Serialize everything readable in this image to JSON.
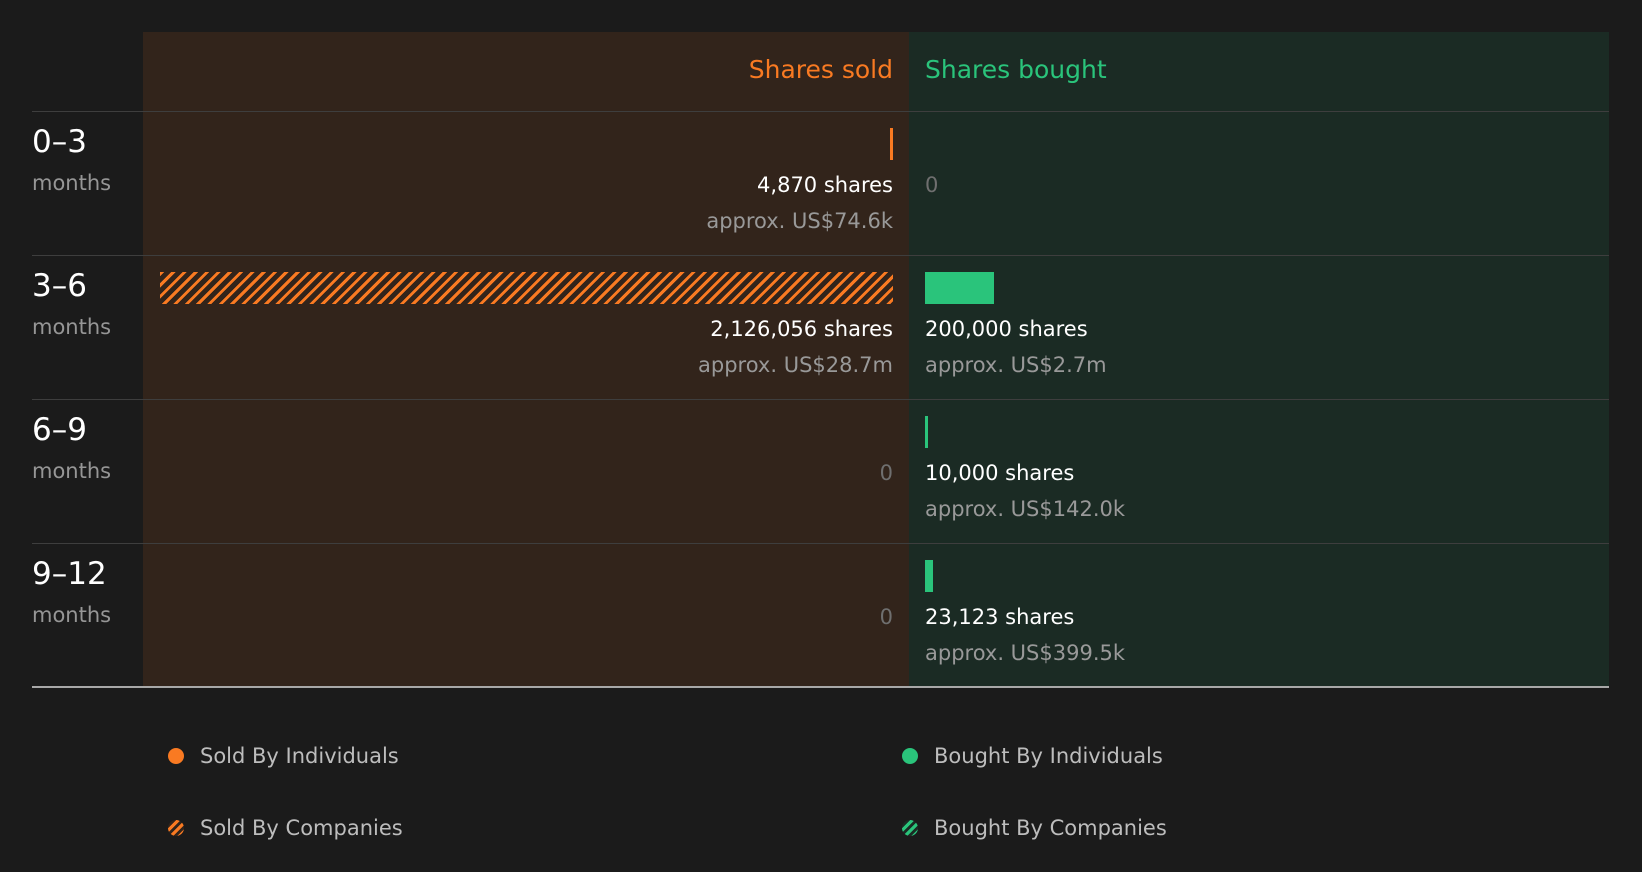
{
  "chart_data": {
    "type": "bar",
    "columns": {
      "sold": "Shares sold",
      "bought": "Shares bought"
    },
    "unit": "months",
    "categories": [
      "0–3",
      "3–6",
      "6–9",
      "9–12"
    ],
    "rows": [
      {
        "range": "0–3",
        "unit": "months",
        "sold": {
          "shares": 4870,
          "shares_text": "4,870 shares",
          "approx_text": "approx. US$74.6k",
          "by": "individuals"
        },
        "bought": {
          "shares": 0,
          "shares_text": "0",
          "approx_text": "",
          "by": ""
        }
      },
      {
        "range": "3–6",
        "unit": "months",
        "sold": {
          "shares": 2126056,
          "shares_text": "2,126,056 shares",
          "approx_text": "approx. US$28.7m",
          "by": "companies"
        },
        "bought": {
          "shares": 200000,
          "shares_text": "200,000 shares",
          "approx_text": "approx. US$2.7m",
          "by": "individuals"
        }
      },
      {
        "range": "6–9",
        "unit": "months",
        "sold": {
          "shares": 0,
          "shares_text": "0",
          "approx_text": "",
          "by": ""
        },
        "bought": {
          "shares": 10000,
          "shares_text": "10,000 shares",
          "approx_text": "approx. US$142.0k",
          "by": "individuals"
        }
      },
      {
        "range": "9–12",
        "unit": "months",
        "sold": {
          "shares": 0,
          "shares_text": "0",
          "approx_text": "",
          "by": ""
        },
        "bought": {
          "shares": 23123,
          "shares_text": "23,123 shares",
          "approx_text": "approx. US$399.5k",
          "by": "individuals"
        }
      }
    ],
    "legend": [
      {
        "key": "sold-ind",
        "label": "Sold By Individuals"
      },
      {
        "key": "bought-ind",
        "label": "Bought By Individuals"
      },
      {
        "key": "sold-co",
        "label": "Sold By Companies"
      },
      {
        "key": "bought-co",
        "label": "Bought By Companies"
      }
    ],
    "legend_placement": "bottom",
    "colors": {
      "sold": "#f97a22",
      "bought": "#2ac47b",
      "sold_bg": "#32241b",
      "bought_bg": "#1b2b24"
    }
  }
}
